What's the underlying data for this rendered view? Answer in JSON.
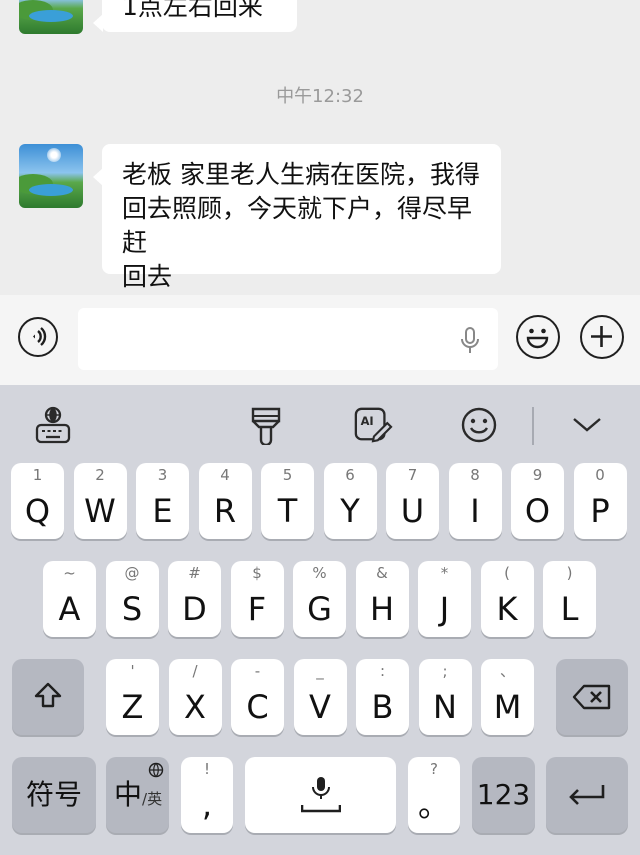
{
  "chat": {
    "prev_message": "1点左右回来",
    "timestamp": "中午12:32",
    "message_lines": [
      "老板  家里老人生病在医院，我得",
      "回去照顾，今天就下户，得尽早赶",
      "回去"
    ]
  },
  "input": {
    "placeholder": ""
  },
  "keyboard": {
    "row1": [
      {
        "sub": "1",
        "main": "Q"
      },
      {
        "sub": "2",
        "main": "W"
      },
      {
        "sub": "3",
        "main": "E"
      },
      {
        "sub": "4",
        "main": "R"
      },
      {
        "sub": "5",
        "main": "T"
      },
      {
        "sub": "6",
        "main": "Y"
      },
      {
        "sub": "7",
        "main": "U"
      },
      {
        "sub": "8",
        "main": "I"
      },
      {
        "sub": "9",
        "main": "O"
      },
      {
        "sub": "0",
        "main": "P"
      }
    ],
    "row2": [
      {
        "sub": "~",
        "main": "A"
      },
      {
        "sub": "@",
        "main": "S"
      },
      {
        "sub": "#",
        "main": "D"
      },
      {
        "sub": "$",
        "main": "F"
      },
      {
        "sub": "%",
        "main": "G"
      },
      {
        "sub": "&",
        "main": "H"
      },
      {
        "sub": "*",
        "main": "J"
      },
      {
        "sub": "(",
        "main": "K"
      },
      {
        "sub": ")",
        "main": "L"
      }
    ],
    "row3": [
      {
        "sub": "'",
        "main": "Z"
      },
      {
        "sub": "/",
        "main": "X"
      },
      {
        "sub": "-",
        "main": "C"
      },
      {
        "sub": "_",
        "main": "V"
      },
      {
        "sub": ":",
        "main": "B"
      },
      {
        "sub": ";",
        "main": "N"
      },
      {
        "sub": "、",
        "main": "M"
      }
    ],
    "symbols_label": "符号",
    "chinese_label": "中",
    "english_small": "/英",
    "comma_sub": "!",
    "comma_main": ",",
    "period_sub": "?",
    "period_main": "。",
    "numbers_label": "123"
  }
}
